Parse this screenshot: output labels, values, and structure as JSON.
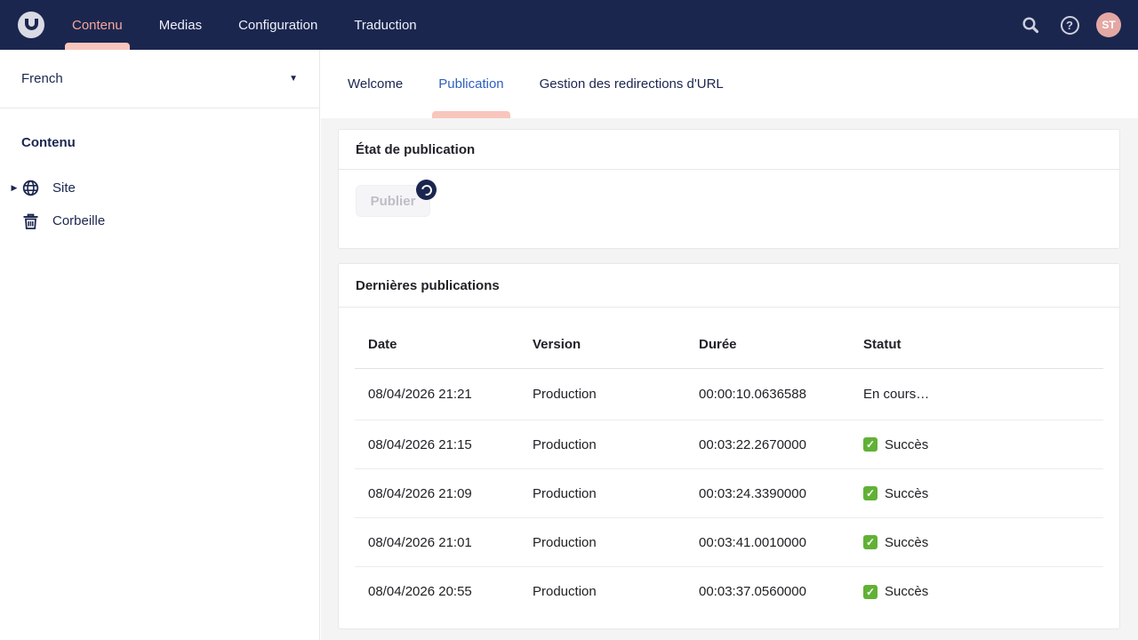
{
  "topbar": {
    "nav": [
      {
        "label": "Contenu",
        "active": true
      },
      {
        "label": "Medias",
        "active": false
      },
      {
        "label": "Configuration",
        "active": false
      },
      {
        "label": "Traduction",
        "active": false
      }
    ],
    "help_glyph": "?",
    "avatar_initials": "ST"
  },
  "sidebar": {
    "language": "French",
    "section_header": "Contenu",
    "tree": [
      {
        "label": "Site",
        "icon": "globe-icon",
        "expandable": true
      },
      {
        "label": "Corbeille",
        "icon": "trash-icon",
        "expandable": false
      }
    ]
  },
  "tabs": [
    {
      "label": "Welcome",
      "active": false
    },
    {
      "label": "Publication",
      "active": true
    },
    {
      "label": "Gestion des redirections d'URL",
      "active": false
    }
  ],
  "publication_state": {
    "title": "État de publication",
    "publish_button": "Publier",
    "publish_disabled": true,
    "loading": true
  },
  "latest_publications": {
    "title": "Dernières publications",
    "columns": [
      "Date",
      "Version",
      "Durée",
      "Statut"
    ],
    "rows": [
      {
        "date": "08/04/2026 21:21",
        "version": "Production",
        "duration": "00:00:10.0636588",
        "status": "En cours…",
        "success": false
      },
      {
        "date": "08/04/2026 21:15",
        "version": "Production",
        "duration": "00:03:22.2670000",
        "status": "Succès",
        "success": true
      },
      {
        "date": "08/04/2026 21:09",
        "version": "Production",
        "duration": "00:03:24.3390000",
        "status": "Succès",
        "success": true
      },
      {
        "date": "08/04/2026 21:01",
        "version": "Production",
        "duration": "00:03:41.0010000",
        "status": "Succès",
        "success": true
      },
      {
        "date": "08/04/2026 20:55",
        "version": "Production",
        "duration": "00:03:37.0560000",
        "status": "Succès",
        "success": true
      }
    ]
  },
  "colors": {
    "topbar_bg": "#1b264f",
    "accent_salmon": "#f8c6bd",
    "active_nav_text": "#f5a79b",
    "active_tab_blue": "#2e5fc0",
    "success_green": "#61b136",
    "avatar_pink": "#e3a8a4",
    "main_bg": "#f4f4f5"
  },
  "glyphs": {
    "check": "✓",
    "caret_down": "▼",
    "tree_arrow": "▶"
  }
}
